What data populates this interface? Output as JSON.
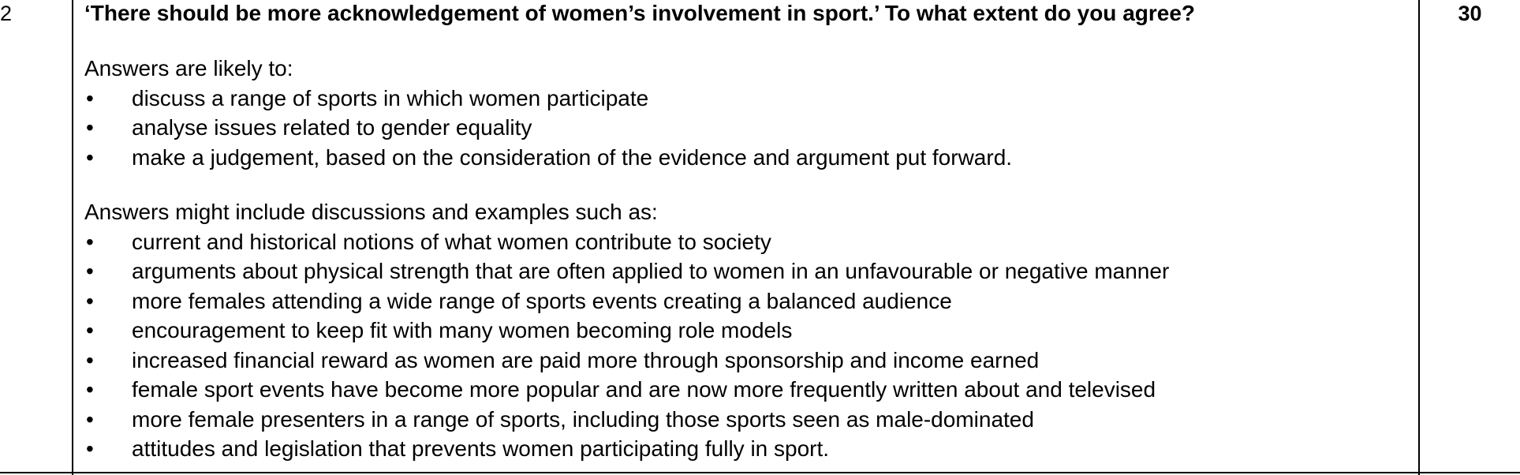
{
  "question": {
    "number": "2",
    "title": "‘There should be more acknowledgement of women’s involvement in sport.’ To what extent do you agree?",
    "marks": "30"
  },
  "section1": {
    "intro": "Answers are likely to:",
    "bullets": [
      "discuss a range of sports in which women participate",
      "analyse issues related to gender equality",
      "make a judgement, based on the consideration of the evidence and argument put forward."
    ]
  },
  "section2": {
    "intro": "Answers might include discussions and examples such as:",
    "bullets": [
      "current and historical notions of what women contribute to society",
      "arguments about physical strength that are often applied to women in an unfavourable or negative manner",
      "more females attending a wide range of sports events creating a balanced audience",
      "encouragement to keep fit with many women becoming role models",
      "increased financial reward as women are paid more through sponsorship and income earned",
      "female sport events have become more popular and are now more frequently written about and televised",
      "more female presenters in a range of sports, including those sports seen as male-dominated",
      "attitudes and legislation that prevents women participating fully in sport."
    ]
  },
  "bullet_symbol": "•"
}
